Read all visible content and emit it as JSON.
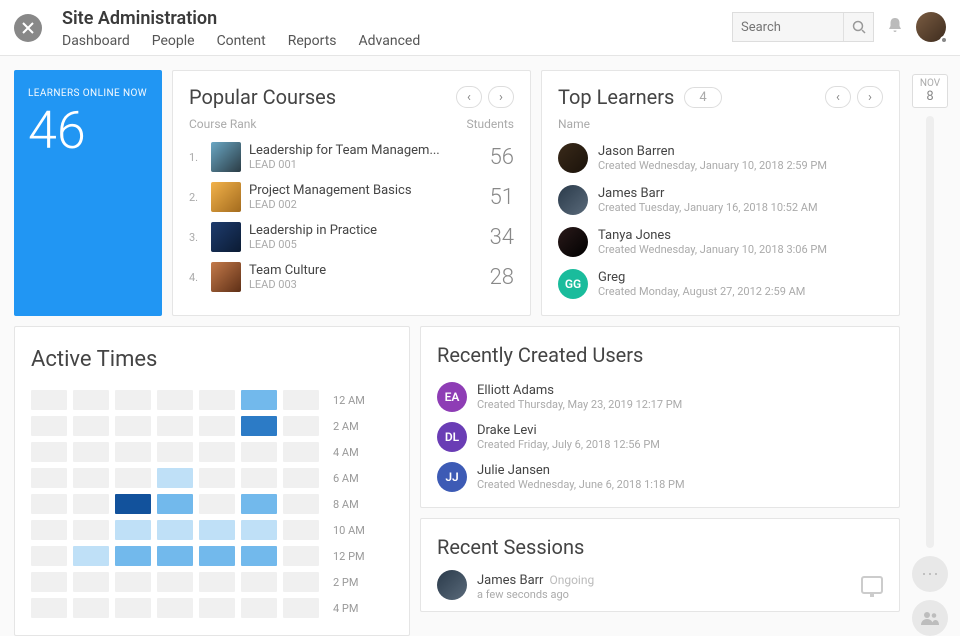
{
  "header": {
    "title": "Site Administration",
    "tabs": [
      "Dashboard",
      "People",
      "Content",
      "Reports",
      "Advanced"
    ],
    "search_placeholder": "Search"
  },
  "date_pill": {
    "month": "NOV",
    "day": "8"
  },
  "learners_online": {
    "label": "LEARNERS ONLINE NOW",
    "count": "46"
  },
  "popular_courses": {
    "title": "Popular Courses",
    "col_rank": "Course Rank",
    "col_students": "Students",
    "items": [
      {
        "rank": "1.",
        "name": "Leadership for Team Managem...",
        "code": "LEAD 001",
        "students": "56",
        "thumb": "linear-gradient(135deg,#6aa7c4,#2b3c45)"
      },
      {
        "rank": "2.",
        "name": "Project Management Basics",
        "code": "LEAD 002",
        "students": "51",
        "thumb": "linear-gradient(135deg,#f2b24a,#a36b1e)"
      },
      {
        "rank": "3.",
        "name": "Leadership in Practice",
        "code": "LEAD 005",
        "students": "34",
        "thumb": "linear-gradient(135deg,#1e3c6e,#0b1b33)"
      },
      {
        "rank": "4.",
        "name": "Team Culture",
        "code": "LEAD 003",
        "students": "28",
        "thumb": "linear-gradient(135deg,#c47a4a,#5e2f16)"
      }
    ]
  },
  "top_learners": {
    "title": "Top Learners",
    "count": "4",
    "col_name": "Name",
    "items": [
      {
        "name": "Jason Barren",
        "meta": "Created Wednesday, January 10, 2018 2:59 PM",
        "avatar_bg": "linear-gradient(135deg,#3a2a1a,#1a120a)",
        "initials": ""
      },
      {
        "name": "James Barr",
        "meta": "Created Tuesday, January 16, 2018 10:52 AM",
        "avatar_bg": "linear-gradient(135deg,#2a3a4a,#5a6a7a)",
        "initials": ""
      },
      {
        "name": "Tanya Jones",
        "meta": "Created Wednesday, January 10, 2018 3:06 PM",
        "avatar_bg": "linear-gradient(135deg,#2a1a1a,#000)",
        "initials": ""
      },
      {
        "name": "Greg",
        "meta": "Created Monday, August 27, 2012 2:59 AM",
        "avatar_bg": "#1abc9c",
        "initials": "GG"
      }
    ]
  },
  "active_times": {
    "title": "Active Times"
  },
  "chart_data": {
    "type": "heatmap",
    "title": "Active Times",
    "y_labels": [
      "12 AM",
      "2 AM",
      "4 AM",
      "6 AM",
      "8 AM",
      "10 AM",
      "12 PM",
      "2 PM",
      "4 PM"
    ],
    "x_count": 7,
    "intensity_scale": {
      "0": "none",
      "1": "low",
      "2": "medium",
      "3": "high",
      "4": "very high"
    },
    "values": [
      [
        0,
        0,
        0,
        0,
        0,
        2,
        0
      ],
      [
        0,
        0,
        0,
        0,
        0,
        3,
        0
      ],
      [
        0,
        0,
        0,
        0,
        0,
        0,
        0
      ],
      [
        0,
        0,
        0,
        1,
        0,
        0,
        0
      ],
      [
        0,
        0,
        4,
        2,
        0,
        2,
        0
      ],
      [
        0,
        0,
        1,
        1,
        1,
        1,
        0
      ],
      [
        0,
        1,
        2,
        2,
        2,
        2,
        0
      ],
      [
        0,
        0,
        0,
        0,
        0,
        0,
        0
      ],
      [
        0,
        0,
        0,
        0,
        0,
        0,
        0
      ]
    ]
  },
  "recent_users": {
    "title": "Recently Created Users",
    "items": [
      {
        "initials": "EA",
        "name": "Elliott Adams",
        "meta": "Created Thursday, May 23, 2019 12:17 PM",
        "color": "#8e3db5"
      },
      {
        "initials": "DL",
        "name": "Drake Levi",
        "meta": "Created Friday, July 6, 2018 12:56 PM",
        "color": "#6a3db5"
      },
      {
        "initials": "JJ",
        "name": "Julie Jansen",
        "meta": "Created Wednesday, June 6, 2018 1:18 PM",
        "color": "#3d5bb5"
      }
    ]
  },
  "recent_sessions": {
    "title": "Recent Sessions",
    "items": [
      {
        "name": "James Barr",
        "status": "Ongoing",
        "meta": "a few seconds ago",
        "avatar_bg": "linear-gradient(135deg,#2a3a4a,#5a6a7a)"
      }
    ]
  }
}
